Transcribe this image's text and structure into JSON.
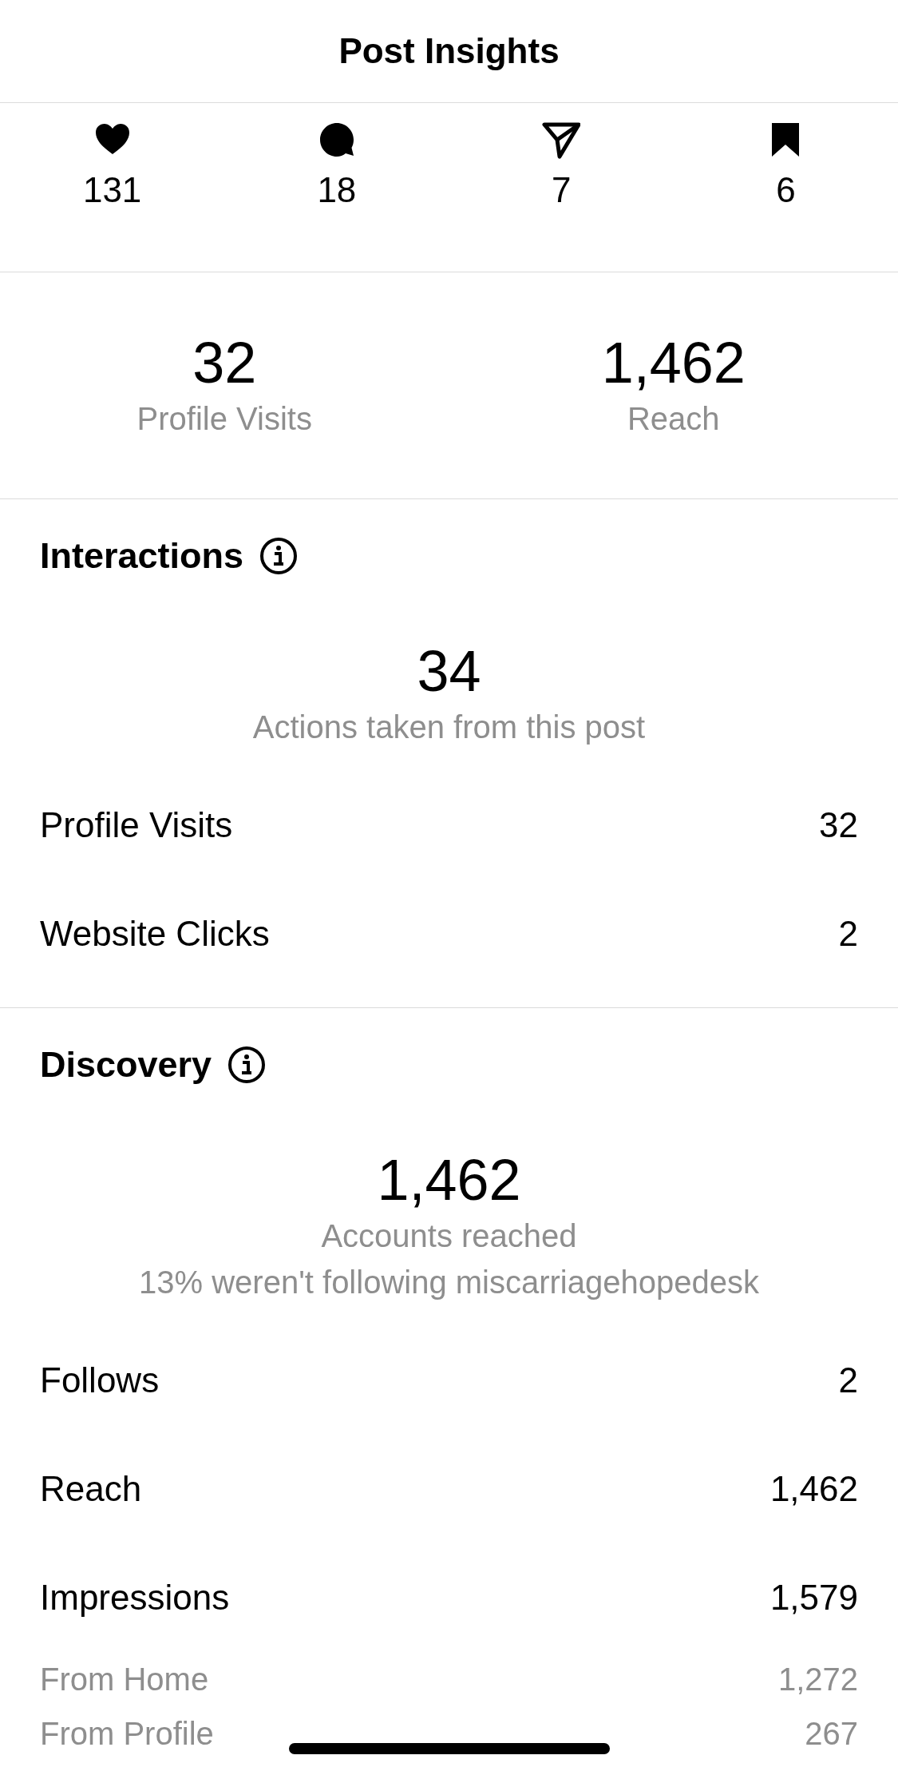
{
  "header": {
    "title": "Post Insights"
  },
  "actions": [
    {
      "kind": "like",
      "count": "131"
    },
    {
      "kind": "comment",
      "count": "18"
    },
    {
      "kind": "share",
      "count": "7"
    },
    {
      "kind": "save",
      "count": "6"
    }
  ],
  "summary": [
    {
      "value": "32",
      "label": "Profile Visits"
    },
    {
      "value": "1,462",
      "label": "Reach"
    }
  ],
  "sections": [
    {
      "title": "Interactions",
      "total": "34",
      "captions": [
        "Actions taken from this post"
      ],
      "rows": [
        {
          "kind": "main",
          "label": "Profile Visits",
          "value": "32"
        },
        {
          "kind": "main",
          "label": "Website Clicks",
          "value": "2"
        }
      ]
    },
    {
      "title": "Discovery",
      "total": "1,462",
      "captions": [
        "Accounts reached",
        "13% weren't following miscarriagehopedesk"
      ],
      "rows": [
        {
          "kind": "main",
          "label": "Follows",
          "value": "2"
        },
        {
          "kind": "main",
          "label": "Reach",
          "value": "1,462"
        },
        {
          "kind": "main",
          "label": "Impressions",
          "value": "1,579"
        },
        {
          "kind": "sub",
          "label": "From Home",
          "value": "1,272"
        },
        {
          "kind": "sub",
          "label": "From Profile",
          "value": "267"
        }
      ]
    }
  ]
}
